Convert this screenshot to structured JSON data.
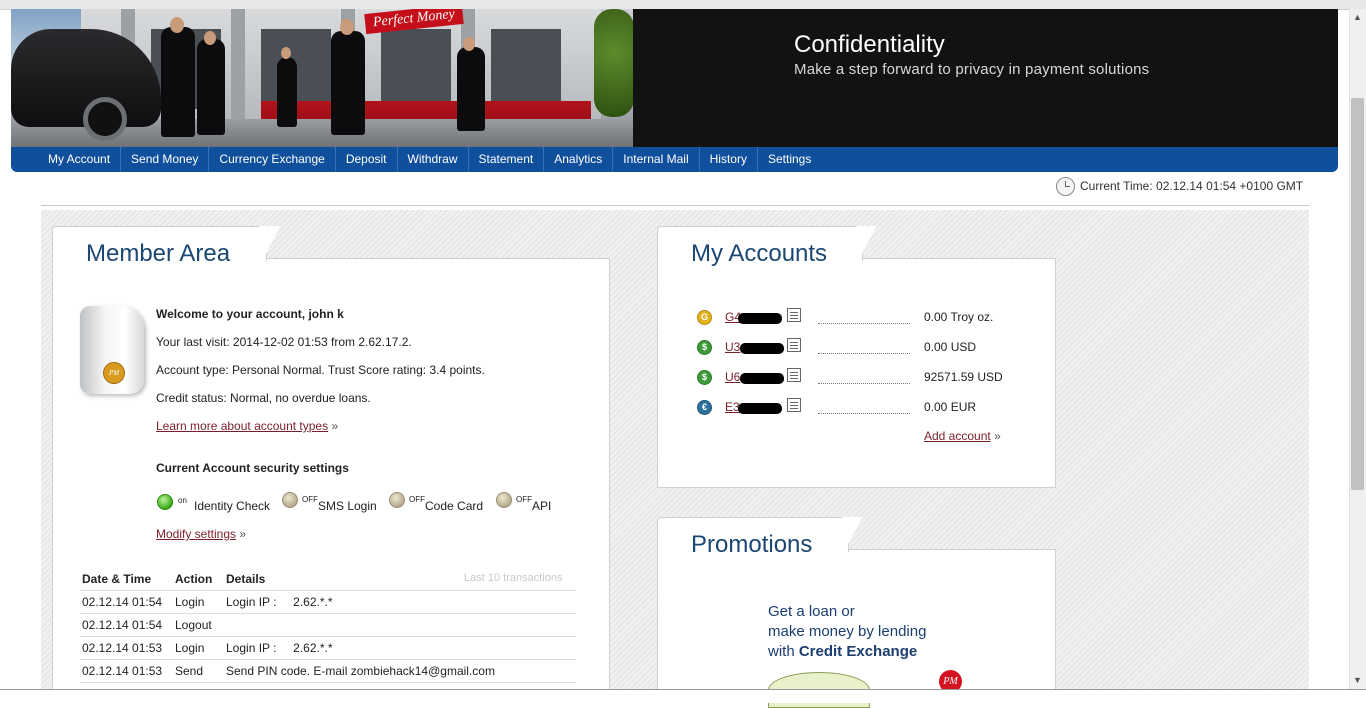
{
  "banner": {
    "sign_text": "Perfect Money",
    "title": "Confidentiality",
    "subtitle": "Make a step forward to privacy in payment solutions"
  },
  "nav": {
    "items": [
      "My Account",
      "Send Money",
      "Currency Exchange",
      "Deposit",
      "Withdraw",
      "Statement",
      "Analytics",
      "Internal Mail",
      "History",
      "Settings"
    ]
  },
  "time": {
    "text": "Current Time: 02.12.14 01:54 +0100 GMT"
  },
  "member": {
    "title": "Member Area",
    "device_badge": "PM",
    "welcome": "Welcome to your account, john k",
    "last_visit": "Your last visit: 2014-12-02 01:53 from       2.62.17.2.",
    "account_type": "Account type: Personal Normal. Trust Score rating: 3.4 points.",
    "credit_status": "Credit status: Normal, no overdue loans.",
    "learn_more": "Learn more about account types",
    "raquo": "»",
    "security_heading": "Current Account security settings",
    "security": [
      {
        "state": "on",
        "label": "Identity Check"
      },
      {
        "state": "OFF",
        "label": "SMS Login"
      },
      {
        "state": "OFF",
        "label": "Code Card"
      },
      {
        "state": "OFF",
        "label": "API"
      }
    ],
    "modify": "Modify settings"
  },
  "transactions": {
    "headers": [
      "Date & Time",
      "Action",
      "Details"
    ],
    "note": "Last 10 transactions",
    "rows": [
      {
        "date": "02.12.14 01:54",
        "action": "Login",
        "details": "Login IP :     2.62.*.*"
      },
      {
        "date": "02.12.14 01:54",
        "action": "Logout",
        "details": ""
      },
      {
        "date": "02.12.14 01:53",
        "action": "Login",
        "details": "Login IP :     2.62.*.*"
      },
      {
        "date": "02.12.14 01:53",
        "action": "Send",
        "details": "Send PIN code. E-mail zombiehack14@gmail.com"
      }
    ]
  },
  "accounts": {
    "title": "My Accounts",
    "items": [
      {
        "icon": "gold",
        "glyph": "G",
        "id": "G4",
        "balance": "0.00 Troy oz."
      },
      {
        "icon": "usd",
        "glyph": "$",
        "id": "U3",
        "balance": "0.00 USD"
      },
      {
        "icon": "usd",
        "glyph": "$",
        "id": "U6",
        "balance": "92571.59 USD"
      },
      {
        "icon": "eur",
        "glyph": "€",
        "id": "E3",
        "balance": "0.00 EUR"
      }
    ],
    "add": "Add account"
  },
  "promo": {
    "title": "Promotions",
    "line1": "Get a loan or",
    "line2": "make money by lending",
    "line3_prefix": "with ",
    "line3_bold": "Credit Exchange",
    "badge": "PM"
  },
  "colors": {
    "nav_bg": "#0f4f9c",
    "heading": "#1b4773",
    "link": "#7a1e2a",
    "banner_bg": "#121212"
  }
}
